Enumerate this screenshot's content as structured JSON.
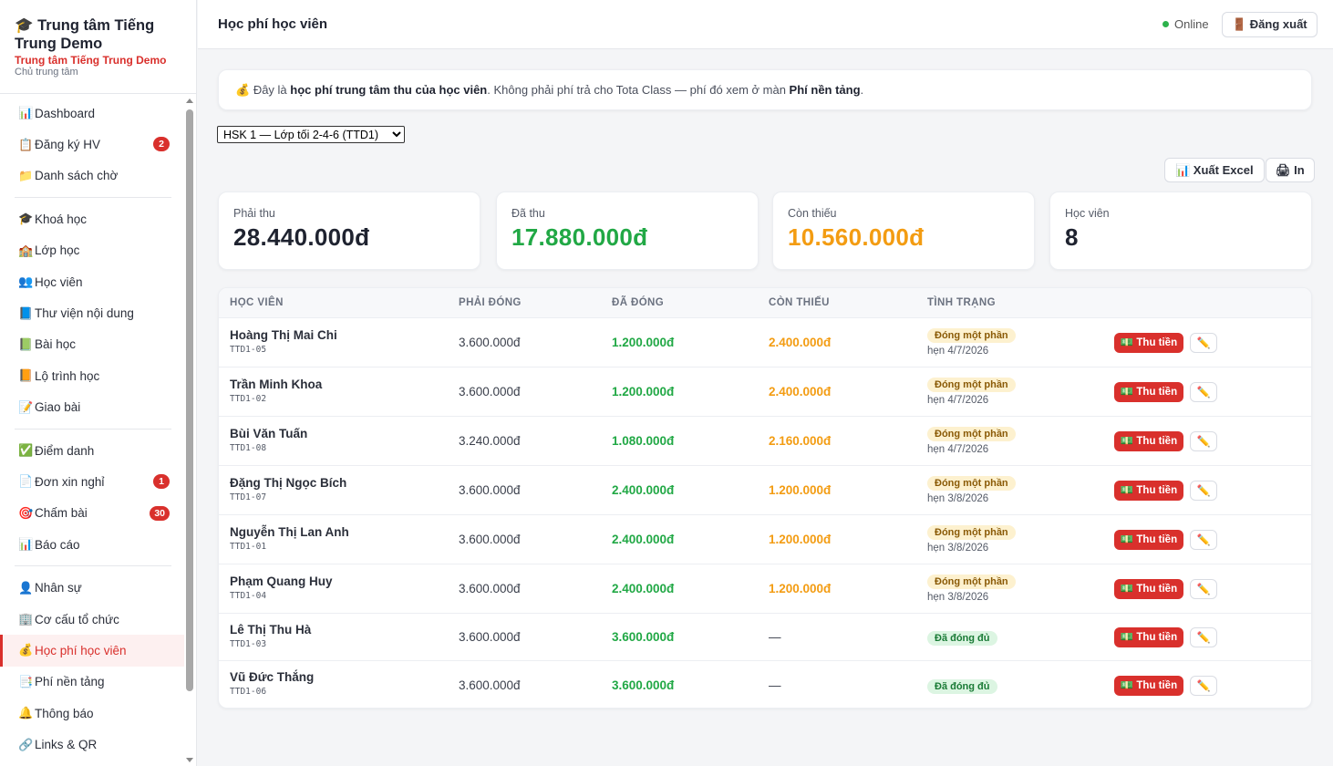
{
  "brand": {
    "title": "🎓 Trung tâm Tiếng Trung Demo",
    "subtitle": "Trung tâm Tiếng Trung Demo",
    "role": "Chủ trung tâm"
  },
  "sidebar": {
    "groups": [
      [
        {
          "icon": "📊",
          "label": "Dashboard",
          "badge": null
        },
        {
          "icon": "📋",
          "label": "Đăng ký HV",
          "badge": "2"
        },
        {
          "icon": "📁",
          "label": "Danh sách chờ",
          "badge": null
        }
      ],
      [
        {
          "icon": "🎓",
          "label": "Khoá học",
          "badge": null
        },
        {
          "icon": "🏫",
          "label": "Lớp học",
          "badge": null
        },
        {
          "icon": "👥",
          "label": "Học viên",
          "badge": null
        },
        {
          "icon": "📘",
          "label": "Thư viện nội dung",
          "badge": null
        },
        {
          "icon": "📗",
          "label": "Bài học",
          "badge": null
        },
        {
          "icon": "📙",
          "label": "Lộ trình học",
          "badge": null
        },
        {
          "icon": "📝",
          "label": "Giao bài",
          "badge": null
        }
      ],
      [
        {
          "icon": "✅",
          "label": "Điểm danh",
          "badge": null
        },
        {
          "icon": "📄",
          "label": "Đơn xin nghỉ",
          "badge": "1"
        },
        {
          "icon": "🎯",
          "label": "Chấm bài",
          "badge": "30"
        },
        {
          "icon": "📊",
          "label": "Báo cáo",
          "badge": null
        }
      ],
      [
        {
          "icon": "👤",
          "label": "Nhân sự",
          "badge": null
        },
        {
          "icon": "🏢",
          "label": "Cơ cấu tổ chức",
          "badge": null
        },
        {
          "icon": "💰",
          "label": "Học phí học viên",
          "badge": null,
          "active": true
        },
        {
          "icon": "📑",
          "label": "Phí nền tảng",
          "badge": null
        },
        {
          "icon": "🔔",
          "label": "Thông báo",
          "badge": null
        },
        {
          "icon": "🔗",
          "label": "Links & QR",
          "badge": null
        }
      ]
    ]
  },
  "header": {
    "title": "Học phí học viên",
    "status": "Online",
    "logout_label": "🚪 Đăng xuất"
  },
  "notice": {
    "icon": "💰",
    "text_1": "Đây là ",
    "bold_1": "học phí trung tâm thu của học viên",
    "text_2": ". Không phải phí trả cho Tota Class — phí đó xem ở màn ",
    "bold_2": "Phí nền tảng",
    "text_3": "."
  },
  "class_select": {
    "selected": "HSK 1 — Lớp tối 2-4-6 (TTD1)"
  },
  "toolbar": {
    "export_label": "📊 Xuất Excel",
    "print_label": "🖨 In"
  },
  "stats": [
    {
      "label": "Phải thu",
      "value": "28.440.000đ",
      "color": "#1f2330"
    },
    {
      "label": "Đã thu",
      "value": "17.880.000đ",
      "color": "#21a845"
    },
    {
      "label": "Còn thiếu",
      "value": "10.560.000đ",
      "color": "#f39c12"
    },
    {
      "label": "Học viên",
      "value": "8",
      "color": "#1f2330"
    }
  ],
  "table": {
    "headers": [
      "HỌC VIÊN",
      "PHẢI ĐÓNG",
      "ĐÃ ĐÓNG",
      "CÒN THIẾU",
      "TÌNH TRẠNG"
    ],
    "pay_label": "💵 Thu tiền",
    "edit_icon": "✏️",
    "rows": [
      {
        "name": "Hoàng Thị Mai Chi",
        "code": "TTD1-05",
        "due": "3.600.000đ",
        "paid": "1.200.000đ",
        "owe": "2.400.000đ",
        "status": "Đóng một phần",
        "status_type": "partial",
        "date": "hẹn 4/7/2026"
      },
      {
        "name": "Trần Minh Khoa",
        "code": "TTD1-02",
        "due": "3.600.000đ",
        "paid": "1.200.000đ",
        "owe": "2.400.000đ",
        "status": "Đóng một phần",
        "status_type": "partial",
        "date": "hẹn 4/7/2026"
      },
      {
        "name": "Bùi Văn Tuấn",
        "code": "TTD1-08",
        "due": "3.240.000đ",
        "paid": "1.080.000đ",
        "owe": "2.160.000đ",
        "status": "Đóng một phần",
        "status_type": "partial",
        "date": "hẹn 4/7/2026"
      },
      {
        "name": "Đặng Thị Ngọc Bích",
        "code": "TTD1-07",
        "due": "3.600.000đ",
        "paid": "2.400.000đ",
        "owe": "1.200.000đ",
        "status": "Đóng một phần",
        "status_type": "partial",
        "date": "hẹn 3/8/2026"
      },
      {
        "name": "Nguyễn Thị Lan Anh",
        "code": "TTD1-01",
        "due": "3.600.000đ",
        "paid": "2.400.000đ",
        "owe": "1.200.000đ",
        "status": "Đóng một phần",
        "status_type": "partial",
        "date": "hẹn 3/8/2026"
      },
      {
        "name": "Phạm Quang Huy",
        "code": "TTD1-04",
        "due": "3.600.000đ",
        "paid": "2.400.000đ",
        "owe": "1.200.000đ",
        "status": "Đóng một phần",
        "status_type": "partial",
        "date": "hẹn 3/8/2026"
      },
      {
        "name": "Lê Thị Thu Hà",
        "code": "TTD1-03",
        "due": "3.600.000đ",
        "paid": "3.600.000đ",
        "owe": "—",
        "status": "Đã đóng đủ",
        "status_type": "full",
        "date": ""
      },
      {
        "name": "Vũ Đức Thắng",
        "code": "TTD1-06",
        "due": "3.600.000đ",
        "paid": "3.600.000đ",
        "owe": "—",
        "status": "Đã đóng đủ",
        "status_type": "full",
        "date": ""
      }
    ]
  }
}
